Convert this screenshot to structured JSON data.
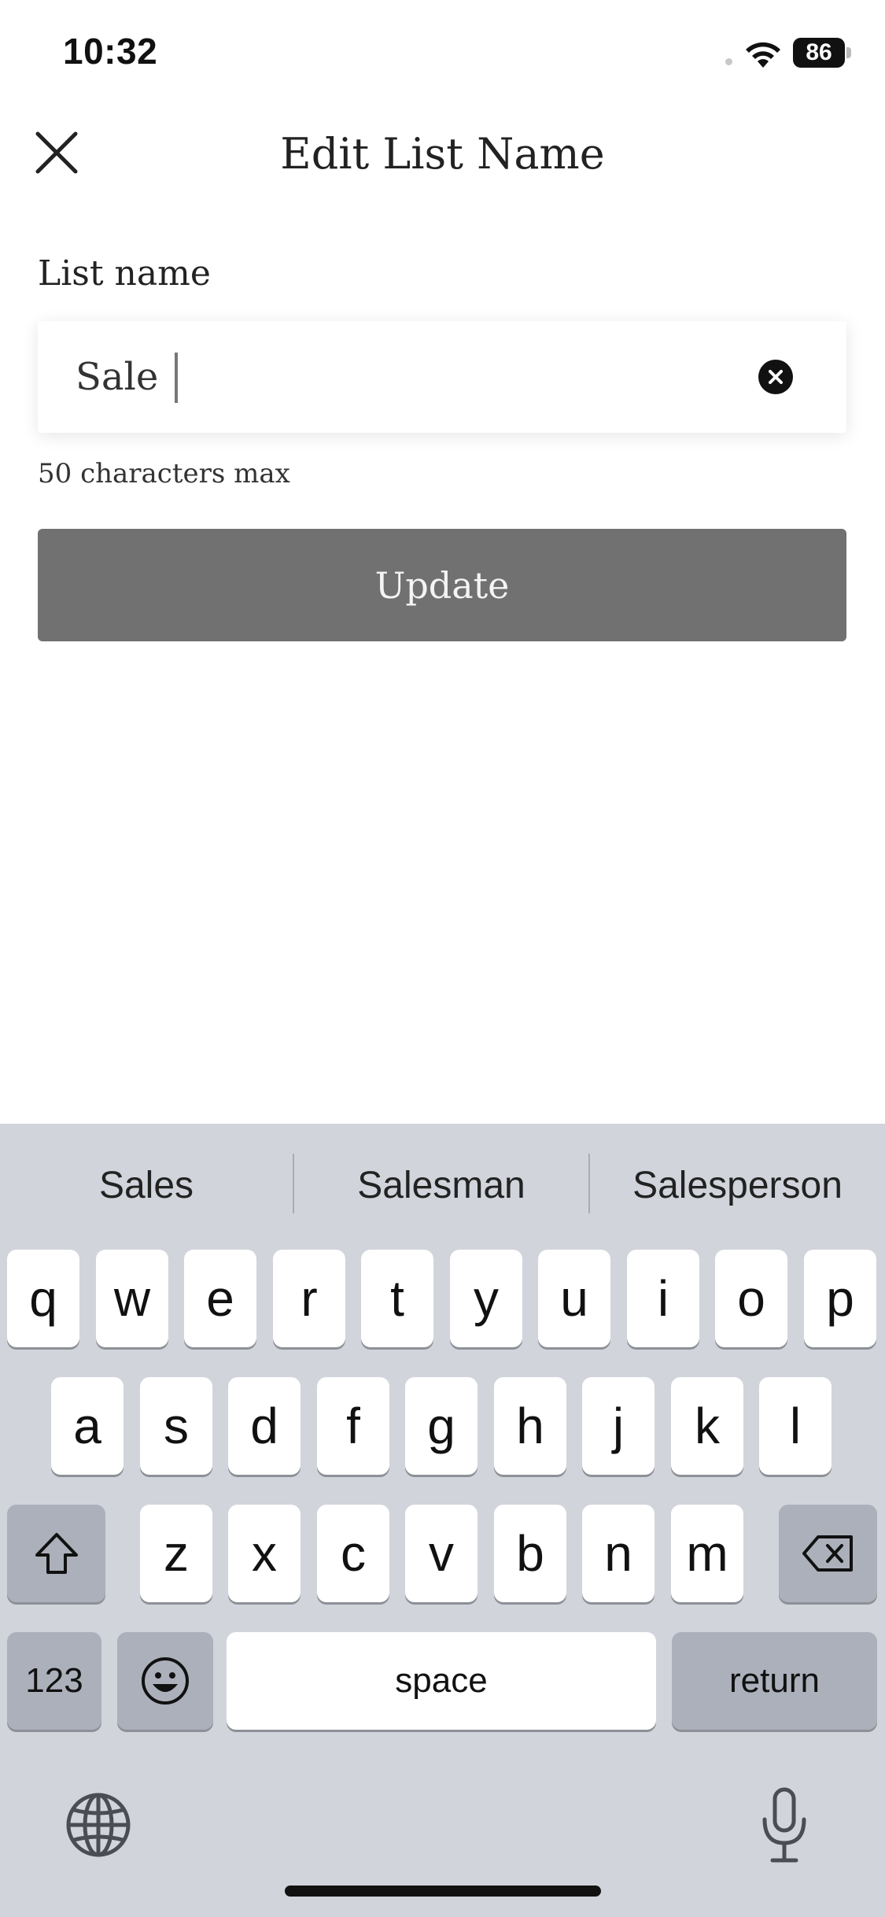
{
  "status_bar": {
    "time": "10:32",
    "battery": "86"
  },
  "header": {
    "title": "Edit List Name"
  },
  "form": {
    "label": "List name",
    "value": "Sale",
    "hint": "50 characters max",
    "submit_label": "Update"
  },
  "keyboard": {
    "suggestions": [
      "Sales",
      "Salesman",
      "Salesperson"
    ],
    "row1": [
      "q",
      "w",
      "e",
      "r",
      "t",
      "y",
      "u",
      "i",
      "o",
      "p"
    ],
    "row2": [
      "a",
      "s",
      "d",
      "f",
      "g",
      "h",
      "j",
      "k",
      "l"
    ],
    "row3": [
      "z",
      "x",
      "c",
      "v",
      "b",
      "n",
      "m"
    ],
    "numbers_label": "123",
    "space_label": "space",
    "return_label": "return"
  }
}
